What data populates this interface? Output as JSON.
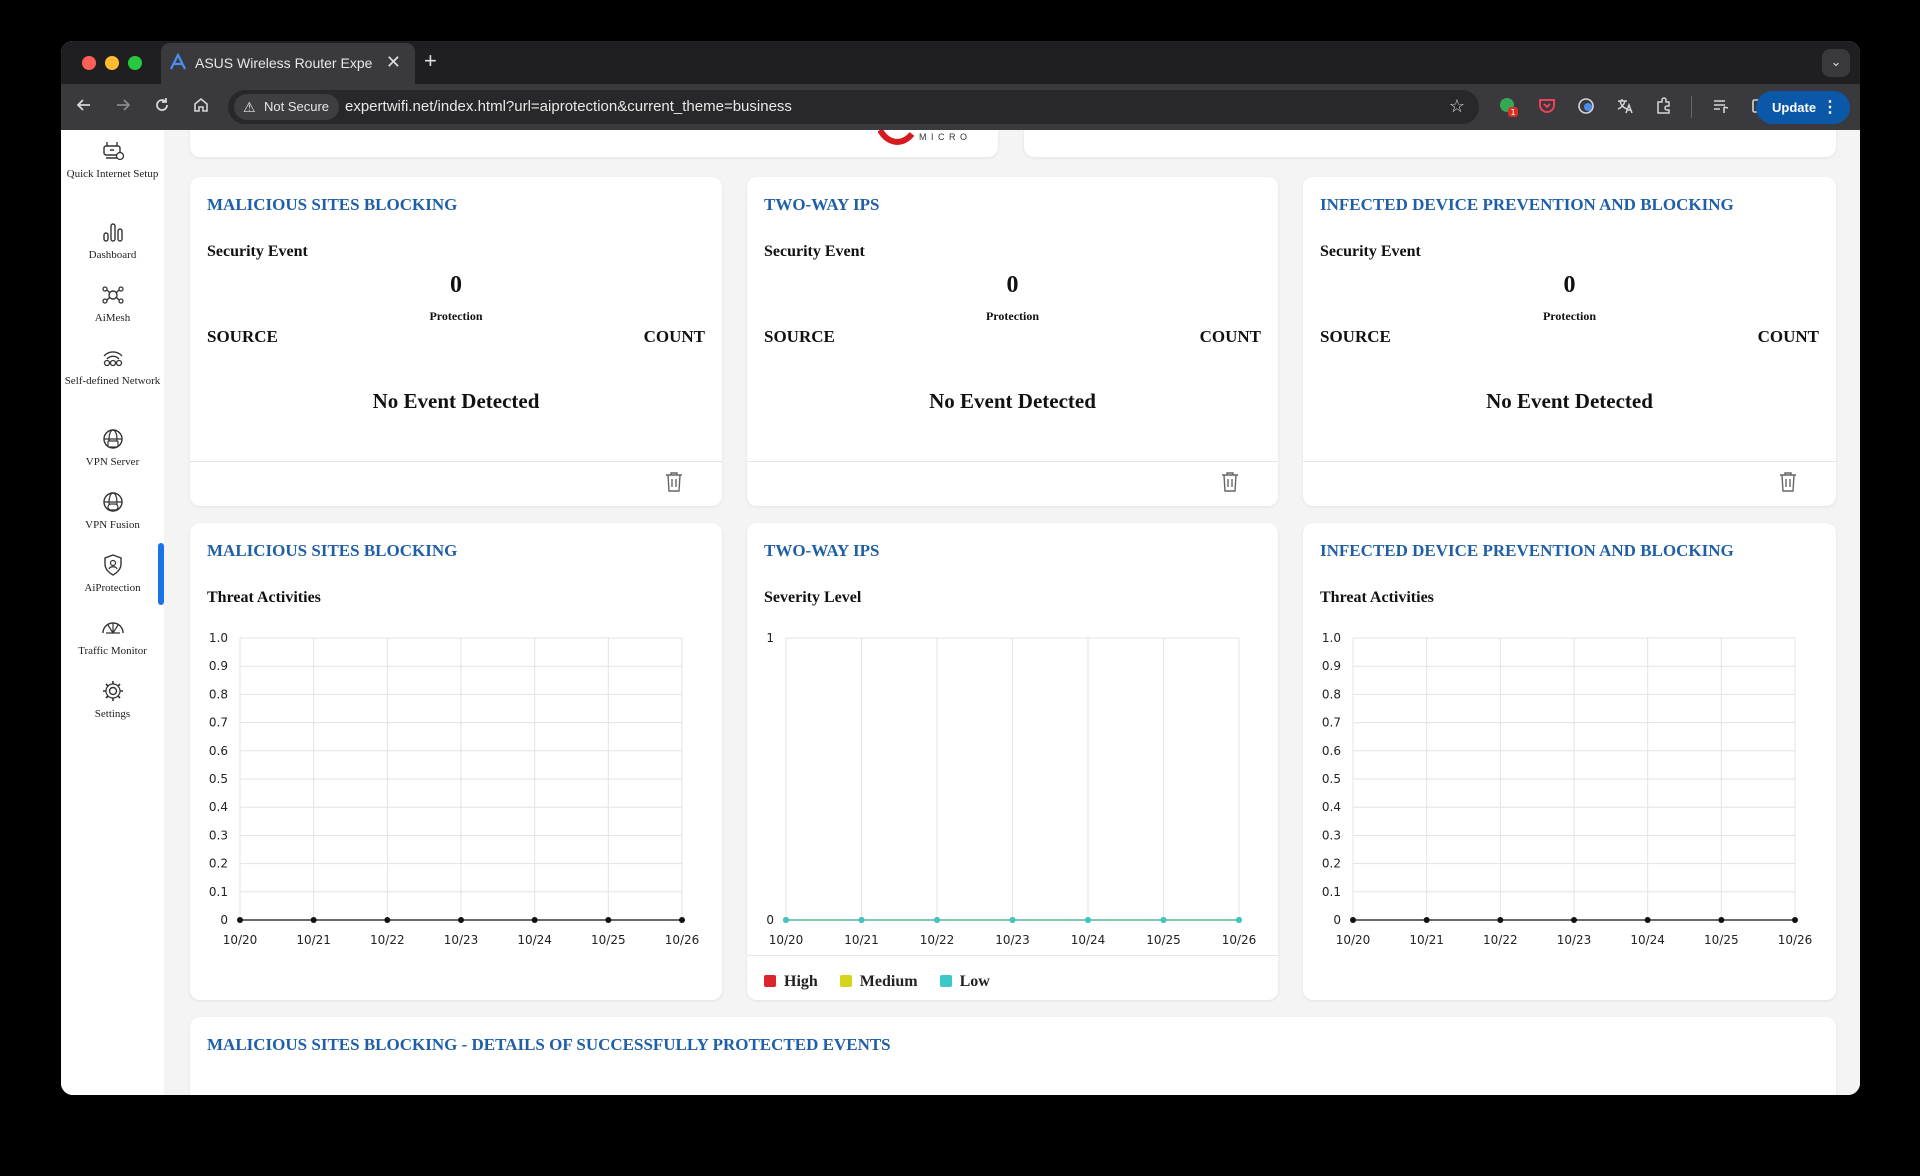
{
  "browser": {
    "tab_title": "ASUS Wireless Router Exper",
    "tab_close": "✕",
    "new_tab": "+",
    "tab_menu": "⌄",
    "security_label": "Not Secure",
    "url": "expertwifi.net/index.html?url=aiprotection&current_theme=business",
    "update_label": "Update",
    "update_menu": "⋮",
    "extension_badge": "1"
  },
  "sidebar": {
    "items": [
      {
        "label": "Quick Internet Setup",
        "icon": "globe-setup-icon"
      },
      {
        "label": "Dashboard",
        "icon": "bar-chart-icon"
      },
      {
        "label": "AiMesh",
        "icon": "mesh-icon"
      },
      {
        "label": "Self-defined Network",
        "icon": "network-icon"
      },
      {
        "label": "VPN Server",
        "icon": "vpn-server-icon"
      },
      {
        "label": "VPN Fusion",
        "icon": "vpn-fusion-icon"
      },
      {
        "label": "AiProtection",
        "icon": "shield-icon",
        "active": true
      },
      {
        "label": "Traffic Monitor",
        "icon": "traffic-icon"
      },
      {
        "label": "Settings",
        "icon": "gear-icon"
      }
    ]
  },
  "top_partial": {
    "logo_text": "M I C R O"
  },
  "event_cards": [
    {
      "title": "MALICIOUS SITES BLOCKING",
      "subtitle": "Security Event",
      "count": "0",
      "count_label": "Protection",
      "col_source": "SOURCE",
      "col_count": "COUNT",
      "empty_text": "No Event Detected"
    },
    {
      "title": "TWO-WAY IPS",
      "subtitle": "Security Event",
      "count": "0",
      "count_label": "Protection",
      "col_source": "SOURCE",
      "col_count": "COUNT",
      "empty_text": "No Event Detected"
    },
    {
      "title": "INFECTED DEVICE PREVENTION AND BLOCKING",
      "subtitle": "Security Event",
      "count": "0",
      "count_label": "Protection",
      "col_source": "SOURCE",
      "col_count": "COUNT",
      "empty_text": "No Event Detected"
    }
  ],
  "chart_cards": [
    {
      "title": "MALICIOUS SITES BLOCKING",
      "subtitle": "Threat Activities"
    },
    {
      "title": "TWO-WAY IPS",
      "subtitle": "Severity Level",
      "legend": [
        "High",
        "Medium",
        "Low"
      ]
    },
    {
      "title": "INFECTED DEVICE PREVENTION AND BLOCKING",
      "subtitle": "Threat Activities"
    }
  ],
  "details_card": {
    "title": "MALICIOUS SITES BLOCKING - DETAILS OF SUCCESSFULLY PROTECTED EVENTS"
  },
  "colors": {
    "title_blue": "#1f5fa8",
    "high": "#d9262c",
    "medium": "#d4d41c",
    "low": "#3cc8c8",
    "accent": "#1a73e8"
  },
  "chart_data": [
    {
      "type": "line",
      "categories": [
        "10/20",
        "10/21",
        "10/22",
        "10/23",
        "10/24",
        "10/25",
        "10/26"
      ],
      "series": [
        {
          "values": [
            0,
            0,
            0,
            0,
            0,
            0,
            0
          ],
          "color": "#111111"
        }
      ],
      "yticks": [
        "0",
        "0.1",
        "0.2",
        "0.3",
        "0.4",
        "0.5",
        "0.6",
        "0.7",
        "0.8",
        "0.9",
        "1.0"
      ],
      "ylim": [
        0,
        1
      ],
      "grid": true
    },
    {
      "type": "line",
      "categories": [
        "10/20",
        "10/21",
        "10/22",
        "10/23",
        "10/24",
        "10/25",
        "10/26"
      ],
      "series": [
        {
          "name": "High",
          "values": [
            0,
            0,
            0,
            0,
            0,
            0,
            0
          ],
          "color": "#d9262c"
        },
        {
          "name": "Medium",
          "values": [
            0,
            0,
            0,
            0,
            0,
            0,
            0
          ],
          "color": "#d4d41c"
        },
        {
          "name": "Low",
          "values": [
            0,
            0,
            0,
            0,
            0,
            0,
            0
          ],
          "color": "#3cc8c8"
        }
      ],
      "yticks": [
        "0",
        "1"
      ],
      "ylim": [
        0,
        1
      ],
      "grid": true,
      "legend_position": "bottom-left"
    },
    {
      "type": "line",
      "categories": [
        "10/20",
        "10/21",
        "10/22",
        "10/23",
        "10/24",
        "10/25",
        "10/26"
      ],
      "series": [
        {
          "values": [
            0,
            0,
            0,
            0,
            0,
            0,
            0
          ],
          "color": "#111111"
        }
      ],
      "yticks": [
        "0",
        "0.1",
        "0.2",
        "0.3",
        "0.4",
        "0.5",
        "0.6",
        "0.7",
        "0.8",
        "0.9",
        "1.0"
      ],
      "ylim": [
        0,
        1
      ],
      "grid": true
    }
  ]
}
